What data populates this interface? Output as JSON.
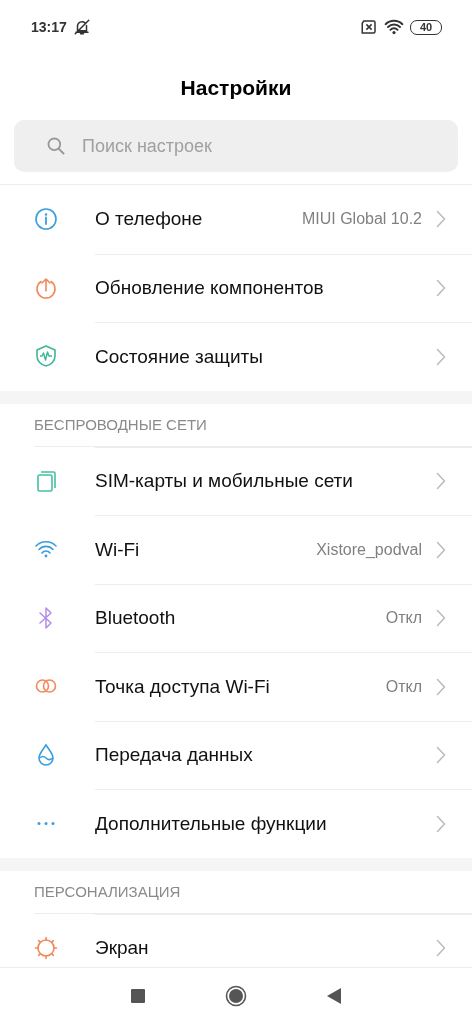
{
  "status_bar": {
    "time": "13:17",
    "battery": "40"
  },
  "title": "Настройки",
  "search": {
    "placeholder": "Поиск настроек"
  },
  "sections": [
    {
      "items": [
        {
          "label": "О телефоне",
          "value": "MIUI Global 10.2"
        },
        {
          "label": "Обновление компонентов"
        },
        {
          "label": "Состояние защиты"
        }
      ]
    },
    {
      "header": "БЕСПРОВОДНЫЕ СЕТИ",
      "items": [
        {
          "label": "SIM-карты и мобильные сети"
        },
        {
          "label": "Wi-Fi",
          "value": "Xistore_podval"
        },
        {
          "label": "Bluetooth",
          "value": "Откл"
        },
        {
          "label": "Точка доступа Wi-Fi",
          "value": "Откл"
        },
        {
          "label": "Передача данных"
        },
        {
          "label": "Дополнительные функции"
        }
      ]
    },
    {
      "header": "ПЕРСОНАЛИЗАЦИЯ",
      "items": [
        {
          "label": "Экран"
        }
      ]
    }
  ]
}
